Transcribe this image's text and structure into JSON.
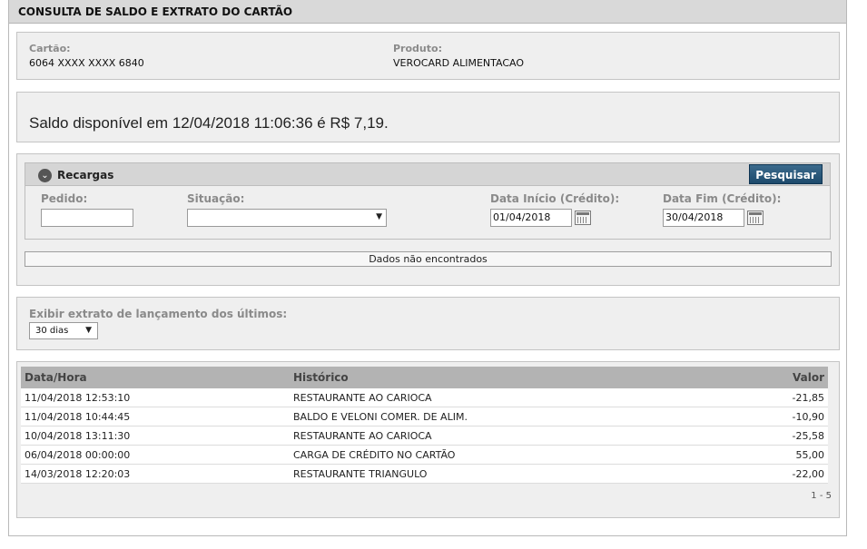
{
  "page_title": "CONSULTA DE SALDO E EXTRATO DO CARTÃO",
  "card": {
    "card_label": "Cartão:",
    "card_number": "6064 XXXX XXXX 6840",
    "product_label": "Produto:",
    "product_value": "VEROCARD ALIMENTACAO"
  },
  "balance_text": "Saldo disponível em 12/04/2018 11:06:36 é R$ 7,19.",
  "recargas": {
    "title": "Recargas",
    "search_button": "Pesquisar",
    "pedido_label": "Pedido:",
    "pedido_value": "",
    "situacao_label": "Situação:",
    "situacao_value": "",
    "data_inicio_label": "Data Início (Crédito):",
    "data_inicio_value": "01/04/2018",
    "data_fim_label": "Data Fim (Crédito):",
    "data_fim_value": "30/04/2018",
    "no_data_text": "Dados não encontrados"
  },
  "statement_filter": {
    "label": "Exibir extrato de lançamento dos últimos:",
    "selected": "30 dias"
  },
  "statement": {
    "columns": [
      "Data/Hora",
      "Histórico",
      "Valor"
    ],
    "rows": [
      {
        "datetime": "11/04/2018 12:53:10",
        "history": "RESTAURANTE AO CARIOCA",
        "value": "-21,85"
      },
      {
        "datetime": "11/04/2018 10:44:45",
        "history": "BALDO E VELONI COMER. DE ALIM.",
        "value": "-10,90"
      },
      {
        "datetime": "10/04/2018 13:11:30",
        "history": "RESTAURANTE AO CARIOCA",
        "value": "-25,58"
      },
      {
        "datetime": "06/04/2018 00:00:00",
        "history": "CARGA DE CRÉDITO NO CARTÃO",
        "value": "55,00"
      },
      {
        "datetime": "14/03/2018 12:20:03",
        "history": "RESTAURANTE TRIANGULO",
        "value": "-22,00"
      }
    ],
    "pager": "1 - 5"
  },
  "colors": {
    "button_bg": "#1d4a6c",
    "header_bg": "#d9d9d9",
    "panel_bg": "#efefef"
  }
}
